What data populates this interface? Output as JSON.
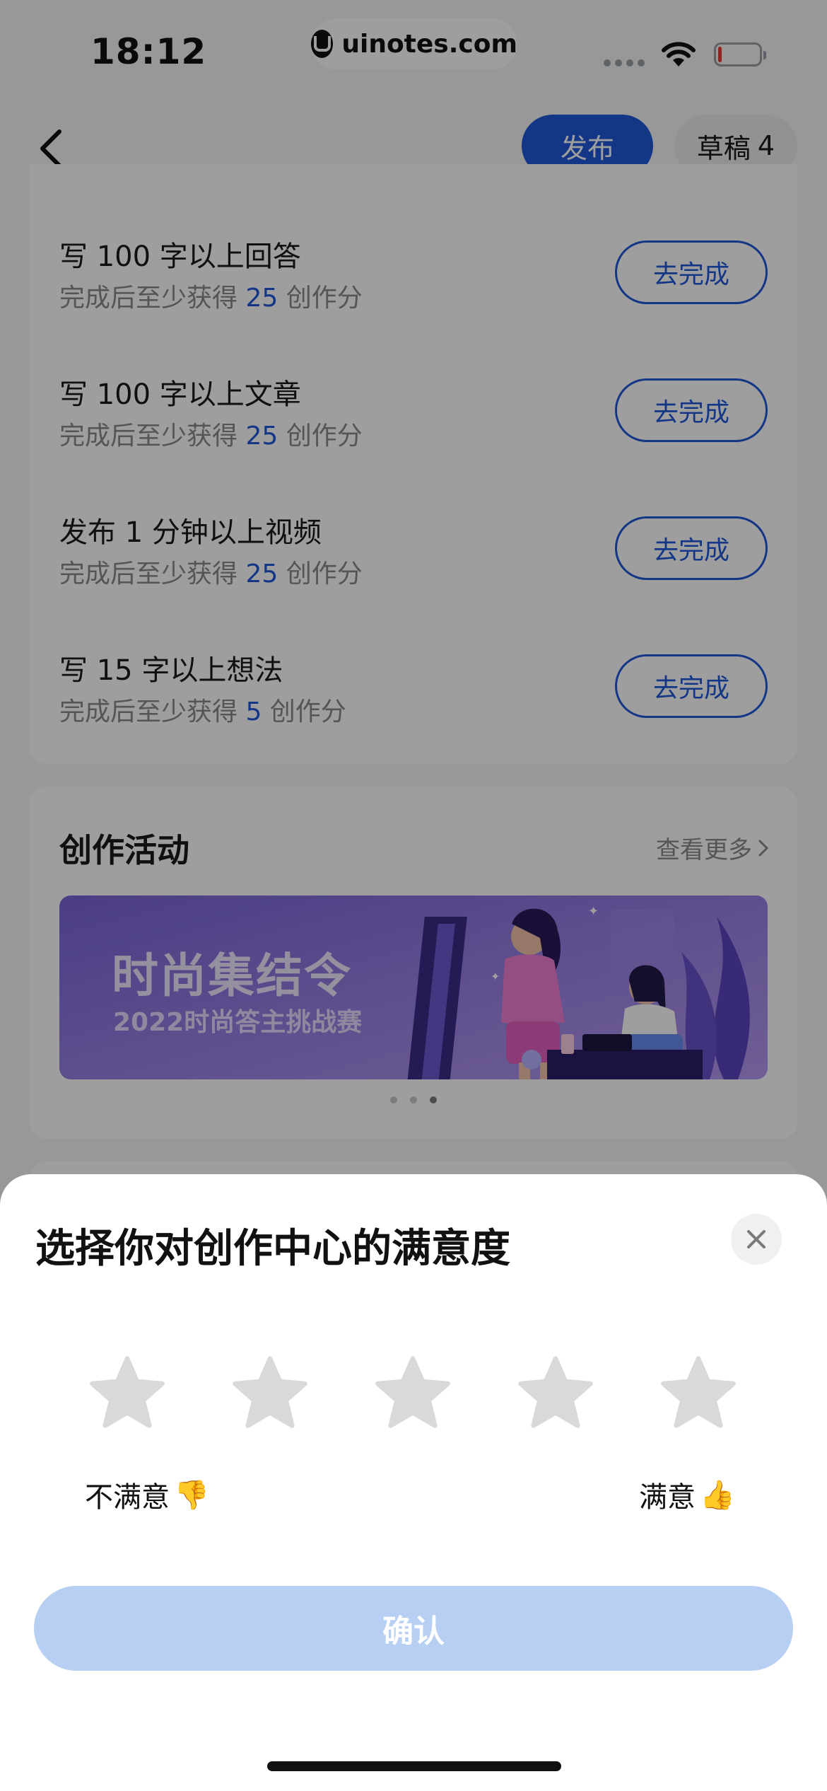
{
  "status_bar": {
    "time": "18:12",
    "url": "uinotes.com"
  },
  "header": {
    "publish_label": "发布",
    "draft_label": "草稿",
    "draft_count": "4"
  },
  "tasks": [
    {
      "title": "写 100 字以上回答",
      "sub_prefix": "完成后至少获得 ",
      "points": "25",
      "sub_suffix": " 创作分",
      "button": "去完成"
    },
    {
      "title": "写 100 字以上文章",
      "sub_prefix": "完成后至少获得 ",
      "points": "25",
      "sub_suffix": " 创作分",
      "button": "去完成"
    },
    {
      "title": "发布 1 分钟以上视频",
      "sub_prefix": "完成后至少获得 ",
      "points": "25",
      "sub_suffix": " 创作分",
      "button": "去完成"
    },
    {
      "title": "写 15 字以上想法",
      "sub_prefix": "完成后至少获得 ",
      "points": "5",
      "sub_suffix": " 创作分",
      "button": "去完成"
    }
  ],
  "activities": {
    "title": "创作活动",
    "more_label": "查看更多",
    "banner_title": "时尚集结令",
    "banner_subtitle": "2022时尚答主挑战赛",
    "pager_count": 3,
    "pager_active": 3
  },
  "rating_sheet": {
    "title": "选择你对创作中心的满意度",
    "star_count": 5,
    "selected_stars": 0,
    "low_label": "不满意",
    "low_emoji": "👎",
    "high_label": "满意",
    "high_emoji": "👍",
    "confirm_label": "确认"
  },
  "colors": {
    "accent": "#1f5ad8",
    "confirm_disabled": "#b8cff4",
    "star_empty": "#d9d9d9"
  }
}
